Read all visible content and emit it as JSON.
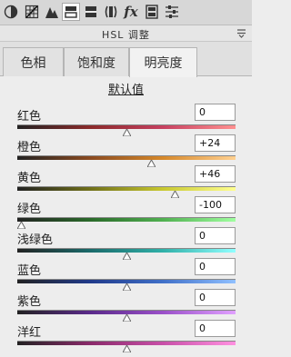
{
  "toolbar": {
    "icons": [
      "basic-panel-icon",
      "tone-curve-icon",
      "detail-icon",
      "hsl-icon",
      "split-toning-icon",
      "lens-corrections-icon",
      "effects-icon",
      "camera-calibration-icon",
      "presets-icon"
    ],
    "effects_label": "fx"
  },
  "panel": {
    "title": "HSL 调整"
  },
  "tabs": [
    {
      "label": "色相"
    },
    {
      "label": "饱和度"
    },
    {
      "label": "明亮度"
    }
  ],
  "reset_label": "默认值",
  "sliders": [
    {
      "label": "红色",
      "value": "0",
      "level": 0,
      "colors": [
        "#222222",
        "#8a2a2a",
        "#c64060",
        "#ff9090"
      ]
    },
    {
      "label": "橙色",
      "value": "+24",
      "level": 24,
      "colors": [
        "#222222",
        "#8a4a20",
        "#d6882a",
        "#ffd090"
      ]
    },
    {
      "label": "黄色",
      "value": "+46",
      "level": 46,
      "colors": [
        "#222222",
        "#70701a",
        "#c8c830",
        "#ffff90"
      ]
    },
    {
      "label": "绿色",
      "value": "-100",
      "level": -100,
      "colors": [
        "#222222",
        "#2a6a2a",
        "#50b050",
        "#a0ffa0"
      ]
    },
    {
      "label": "浅绿色",
      "value": "0",
      "level": 0,
      "colors": [
        "#222222",
        "#1a6a6a",
        "#30b0a8",
        "#90ffff"
      ]
    },
    {
      "label": "蓝色",
      "value": "0",
      "level": 0,
      "colors": [
        "#222222",
        "#203a8a",
        "#4070c8",
        "#90c0ff"
      ]
    },
    {
      "label": "紫色",
      "value": "0",
      "level": 0,
      "colors": [
        "#222222",
        "#5a2a8a",
        "#9a50c8",
        "#e0a0ff"
      ]
    },
    {
      "label": "洋红",
      "value": "0",
      "level": 0,
      "colors": [
        "#222222",
        "#8a2a6a",
        "#c850a8",
        "#ff90e0"
      ]
    }
  ]
}
